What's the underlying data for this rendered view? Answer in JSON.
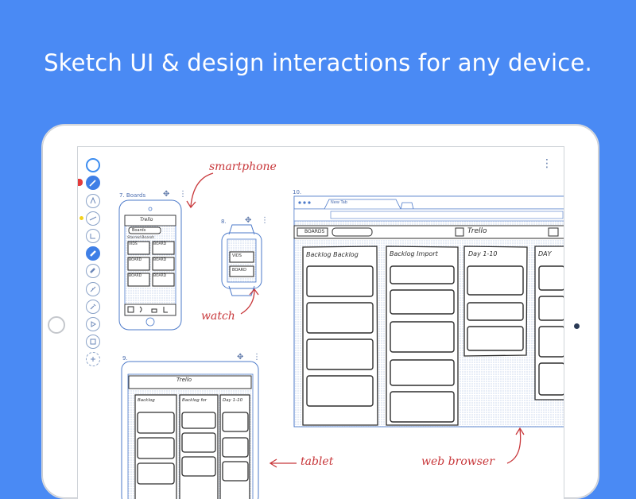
{
  "headline": "Sketch UI & design interactions for any device.",
  "frames": {
    "phone": {
      "label": "7. Boards",
      "app": "Trello",
      "button": "Boards",
      "section": "Starred Boards",
      "cards": [
        "VIDS",
        "BOARD",
        "BOARD",
        "BOARD",
        "BOARD",
        "BOARD"
      ]
    },
    "watch": {
      "label": "8.",
      "items": [
        "VIDS",
        "BOARD"
      ]
    },
    "tablet": {
      "label": "9.",
      "app": "Trello",
      "columns": [
        "Backlog",
        "Backlog for",
        "Day 1-10"
      ]
    },
    "browser": {
      "label": "10.",
      "tab": "New Tab",
      "boards_button": "BOARDS",
      "app": "Trello",
      "columns": [
        "Backlog Backlog",
        "Backlog Import",
        "Day 1-10",
        "DAY"
      ]
    }
  },
  "annotations": {
    "smartphone": "smartphone",
    "watch": "watch",
    "tablet": "tablet",
    "browser": "web browser"
  },
  "colors": {
    "background": "#4a8af4",
    "wireframe": "#4b79c9",
    "sketch": "#2d2d2d",
    "annotation": "#c8373a"
  }
}
